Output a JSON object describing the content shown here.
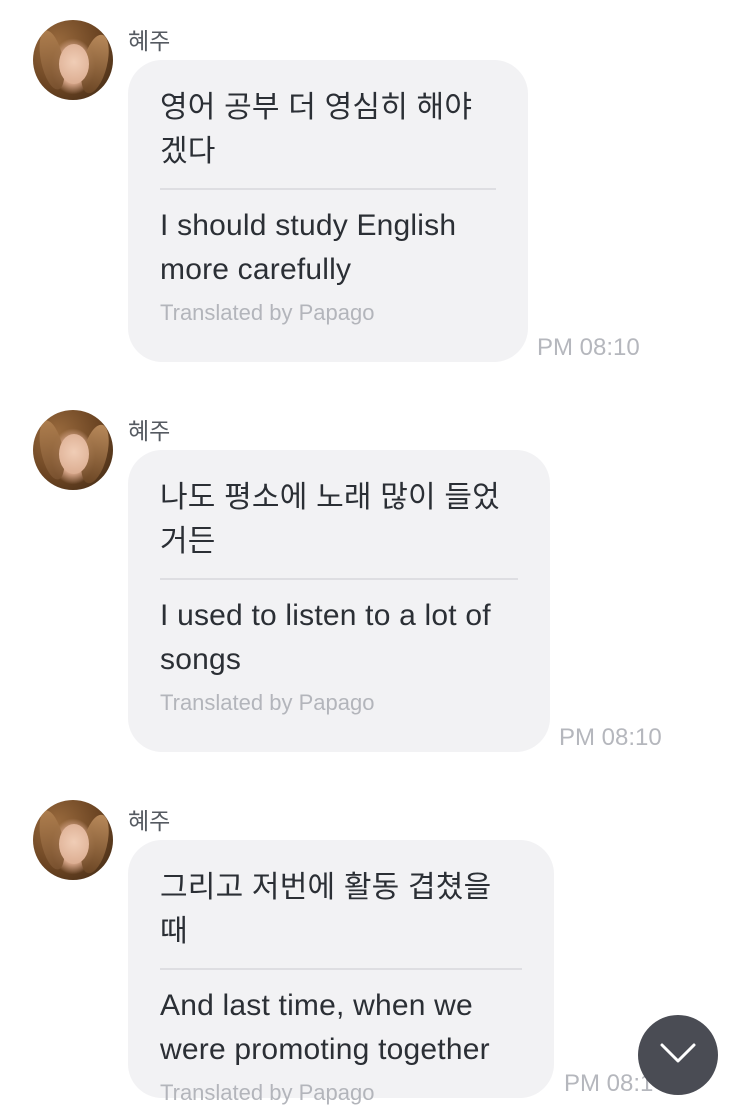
{
  "messages": [
    {
      "sender": "혜주",
      "original": "영어 공부 더 영심히 해야겠다",
      "translation": "I should study English more carefully",
      "credit": "Translated by Papago",
      "time": "PM 08:10"
    },
    {
      "sender": "혜주",
      "original": "나도 평소에 노래 많이 들었거든",
      "translation": "I used to listen to a lot of songs",
      "credit": "Translated by Papago",
      "time": "PM 08:10"
    },
    {
      "sender": "혜주",
      "original": "그리고 저번에 활동 겹쳤을 때",
      "translation": "And last time, when we were promoting together",
      "credit": "Translated by Papago",
      "time": "PM 08:1"
    }
  ],
  "scroll_button": {
    "icon": "chevron-down-icon"
  },
  "colors": {
    "bubble": "#f2f2f4",
    "text": "#2b2f35",
    "muted": "#b3b5bb",
    "fab": "#4a4c54"
  }
}
